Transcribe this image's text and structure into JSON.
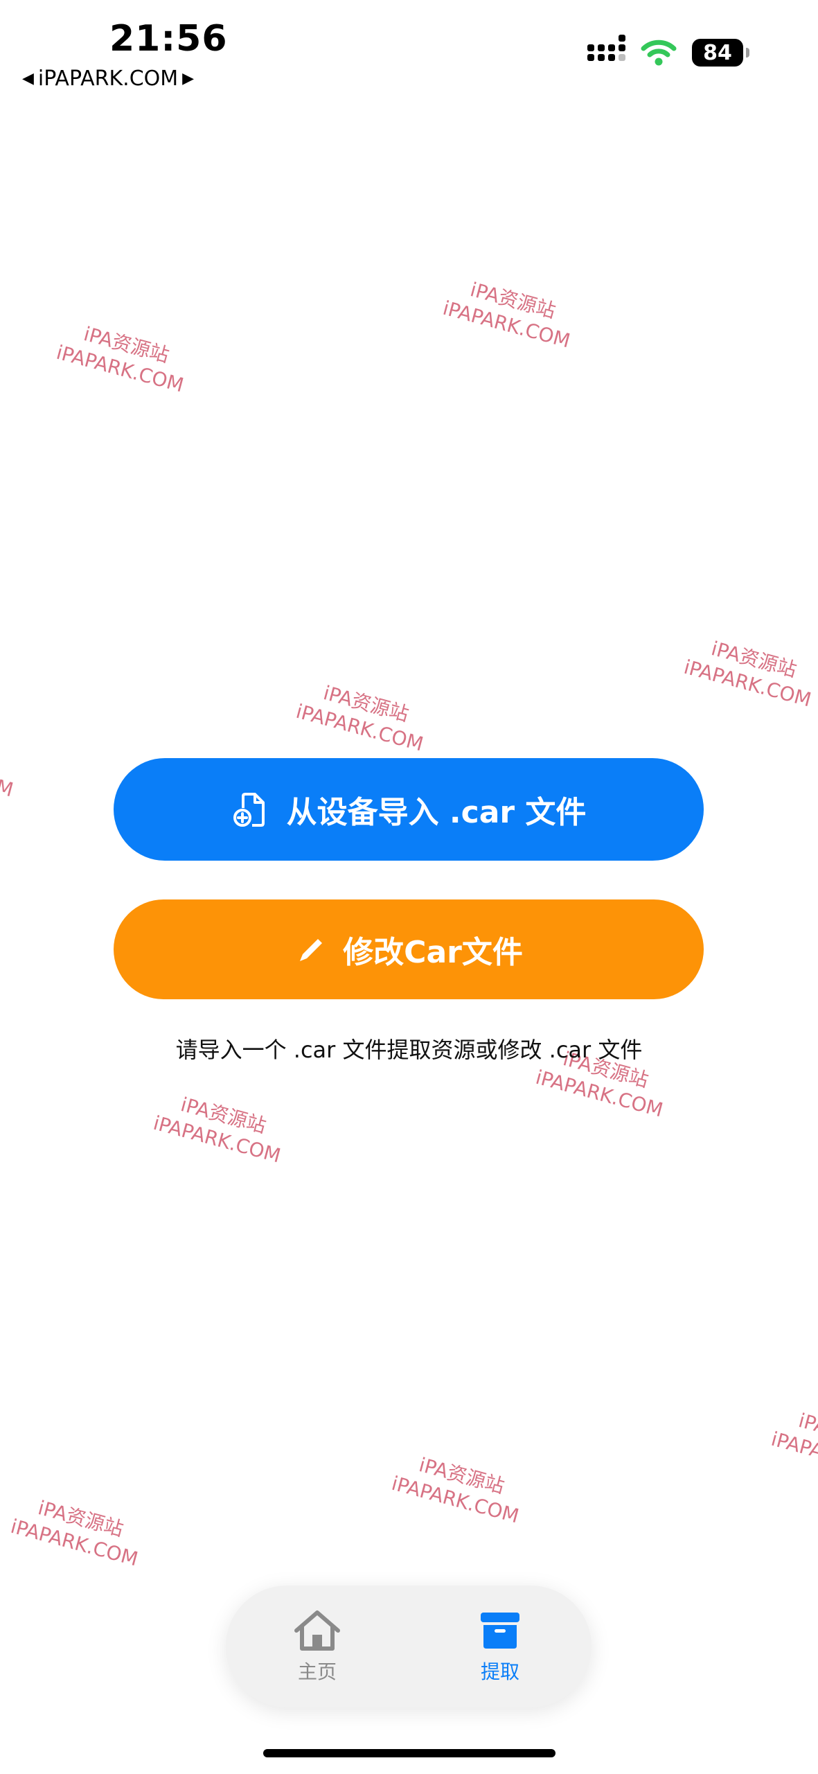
{
  "status_bar": {
    "time": "21:56",
    "back_label": "iPAPARK.COM",
    "battery": "84"
  },
  "watermark": {
    "line1": "iPA资源站",
    "line2": "iPAPARK.COM"
  },
  "main": {
    "import_button_label": "从设备导入 .car 文件",
    "edit_button_label": "修改Car文件",
    "hint_text": "请导入一个 .car 文件提取资源或修改 .car 文件"
  },
  "tab_bar": {
    "tabs": [
      {
        "label": "主页",
        "icon": "house-icon",
        "active": false
      },
      {
        "label": "提取",
        "icon": "archive-box-icon",
        "active": true
      }
    ]
  },
  "colors": {
    "primary_blue": "#0a7ef8",
    "accent_orange": "#fd9307",
    "watermark": "#c83c55",
    "wifi_green": "#34c759"
  }
}
